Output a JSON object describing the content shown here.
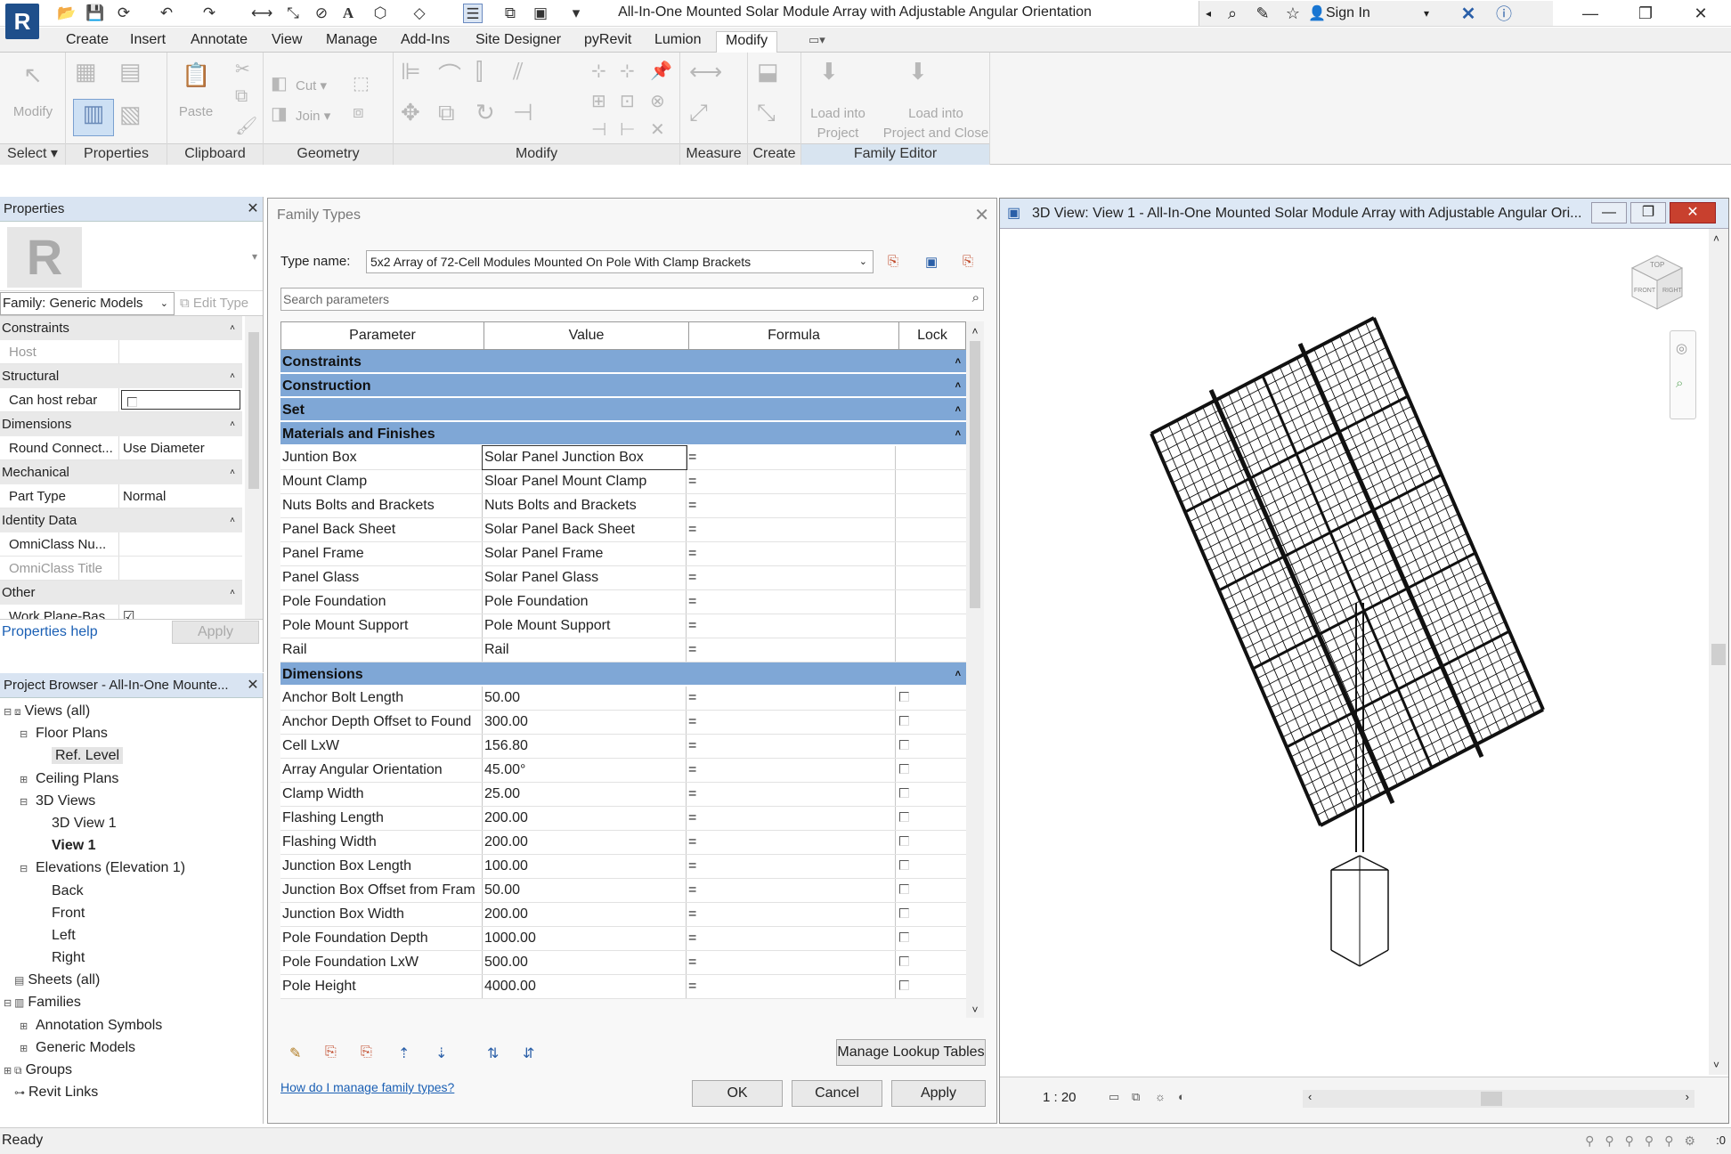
{
  "app": {
    "logo": "R",
    "window_title": "All-In-One Mounted Solar Module Array with Adjustable Angular Orientation",
    "sign_in": "Sign In"
  },
  "ribbon": {
    "tabs": [
      "Create",
      "Insert",
      "Annotate",
      "View",
      "Manage",
      "Add-Ins",
      "Site Designer",
      "pyRevit",
      "Lumion",
      "Modify"
    ],
    "active_tab": "Modify",
    "panels": {
      "select": "Select",
      "properties": "Properties",
      "clipboard": "Clipboard",
      "geometry": "Geometry",
      "modify": "Modify",
      "measure": "Measure",
      "create": "Create",
      "family_editor": "Family Editor"
    },
    "buttons": {
      "modify": "Modify",
      "paste": "Paste",
      "cut": "Cut",
      "join": "Join",
      "load_into_project_1": "Load into",
      "load_into_project_2": "Project",
      "load_close_1": "Load into",
      "load_close_2": "Project and Close"
    }
  },
  "properties": {
    "title": "Properties",
    "type_selector": "Family: Generic Models",
    "edit_type": "Edit Type",
    "help": "Properties help",
    "apply": "Apply",
    "groups": [
      {
        "name": "Constraints",
        "rows": [
          {
            "name": "Host",
            "value": "",
            "disabled": true
          }
        ]
      },
      {
        "name": "Structural",
        "rows": [
          {
            "name": "Can host rebar",
            "value": "",
            "checkbox": true
          }
        ]
      },
      {
        "name": "Dimensions",
        "rows": [
          {
            "name": "Round Connect...",
            "value": "Use Diameter"
          }
        ]
      },
      {
        "name": "Mechanical",
        "rows": [
          {
            "name": "Part Type",
            "value": "Normal"
          }
        ]
      },
      {
        "name": "Identity Data",
        "rows": [
          {
            "name": "OmniClass Nu...",
            "value": ""
          },
          {
            "name": "OmniClass Title",
            "value": "",
            "disabled": true
          }
        ]
      },
      {
        "name": "Other",
        "rows": [
          {
            "name": "Work Plane-Bas...",
            "value": "",
            "checkbox": true,
            "checked": true
          }
        ]
      }
    ]
  },
  "project_browser": {
    "title": "Project Browser - All-In-One Mounte...",
    "items": [
      {
        "label": "Views (all)",
        "indent": 0,
        "toggle": "⊟",
        "icon": "views"
      },
      {
        "label": "Floor Plans",
        "indent": 1,
        "toggle": "⊟"
      },
      {
        "label": "Ref. Level",
        "indent": 2,
        "selected": true
      },
      {
        "label": "Ceiling Plans",
        "indent": 1,
        "toggle": "⊞"
      },
      {
        "label": "3D Views",
        "indent": 1,
        "toggle": "⊟"
      },
      {
        "label": "3D View 1",
        "indent": 2
      },
      {
        "label": "View 1",
        "indent": 2,
        "bold": true
      },
      {
        "label": "Elevations (Elevation 1)",
        "indent": 1,
        "toggle": "⊟"
      },
      {
        "label": "Back",
        "indent": 2
      },
      {
        "label": "Front",
        "indent": 2
      },
      {
        "label": "Left",
        "indent": 2
      },
      {
        "label": "Right",
        "indent": 2
      },
      {
        "label": "Sheets (all)",
        "indent": 0,
        "toggle": "",
        "icon": "sheets"
      },
      {
        "label": "Families",
        "indent": 0,
        "toggle": "⊟",
        "icon": "families"
      },
      {
        "label": "Annotation Symbols",
        "indent": 1,
        "toggle": "⊞"
      },
      {
        "label": "Generic Models",
        "indent": 1,
        "toggle": "⊞"
      },
      {
        "label": "Groups",
        "indent": 0,
        "toggle": "⊞",
        "icon": "groups"
      },
      {
        "label": "Revit Links",
        "indent": 0,
        "toggle": "",
        "icon": "links"
      }
    ]
  },
  "family_types": {
    "title": "Family Types",
    "type_name_label": "Type name:",
    "type_name": "5x2 Array of 72-Cell Modules Mounted On Pole With Clamp Brackets",
    "search_placeholder": "Search parameters",
    "columns": [
      "Parameter",
      "Value",
      "Formula",
      "Lock"
    ],
    "collapsed_groups": [
      "Constraints",
      "Construction",
      "Set"
    ],
    "materials_group": "Materials and Finishes",
    "materials": [
      {
        "param": "Juntion Box",
        "value": "Solar Panel Junction Box",
        "formula": "="
      },
      {
        "param": "Mount Clamp",
        "value": "Sloar Panel Mount Clamp",
        "formula": "="
      },
      {
        "param": "Nuts Bolts and Brackets",
        "value": "Nuts Bolts and Brackets",
        "formula": "="
      },
      {
        "param": "Panel Back Sheet",
        "value": "Solar Panel Back Sheet",
        "formula": "="
      },
      {
        "param": "Panel Frame",
        "value": "Solar Panel Frame",
        "formula": "="
      },
      {
        "param": "Panel Glass",
        "value": "Solar Panel Glass",
        "formula": "="
      },
      {
        "param": "Pole Foundation",
        "value": "Pole Foundation",
        "formula": "="
      },
      {
        "param": "Pole Mount Support",
        "value": "Pole Mount Support",
        "formula": "="
      },
      {
        "param": "Rail",
        "value": "Rail",
        "formula": "="
      }
    ],
    "dimensions_group": "Dimensions",
    "dimensions": [
      {
        "param": "Anchor Bolt Length",
        "value": "50.00",
        "formula": "="
      },
      {
        "param": "Anchor Depth Offset to Found",
        "value": "300.00",
        "formula": "="
      },
      {
        "param": "Cell LxW",
        "value": "156.80",
        "formula": "="
      },
      {
        "param": "Array Angular Orientation",
        "value": "45.00°",
        "formula": "="
      },
      {
        "param": "Clamp Width",
        "value": "25.00",
        "formula": "="
      },
      {
        "param": "Flashing Length",
        "value": "200.00",
        "formula": "="
      },
      {
        "param": "Flashing Width",
        "value": "200.00",
        "formula": "="
      },
      {
        "param": "Junction Box Length",
        "value": "100.00",
        "formula": "="
      },
      {
        "param": "Junction Box Offset from Fram",
        "value": "50.00",
        "formula": "="
      },
      {
        "param": "Junction Box Width",
        "value": "200.00",
        "formula": "="
      },
      {
        "param": "Pole Foundation Depth",
        "value": "1000.00",
        "formula": "="
      },
      {
        "param": "Pole Foundation LxW",
        "value": "500.00",
        "formula": "="
      },
      {
        "param": "Pole Height",
        "value": "4000.00",
        "formula": "="
      }
    ],
    "manage_lookup": "Manage Lookup Tables",
    "help_link": "How do I manage family types?",
    "ok": "OK",
    "cancel": "Cancel",
    "apply": "Apply"
  },
  "view3d": {
    "title": "3D View: View 1 - All-In-One Mounted Solar Module Array with Adjustable Angular Ori...",
    "scale": "1 : 20",
    "viewcube_top": "TOP",
    "viewcube_front": "FRONT",
    "viewcube_right": "RIGHT"
  },
  "status": {
    "text": "Ready",
    "filter_count": ":0"
  }
}
